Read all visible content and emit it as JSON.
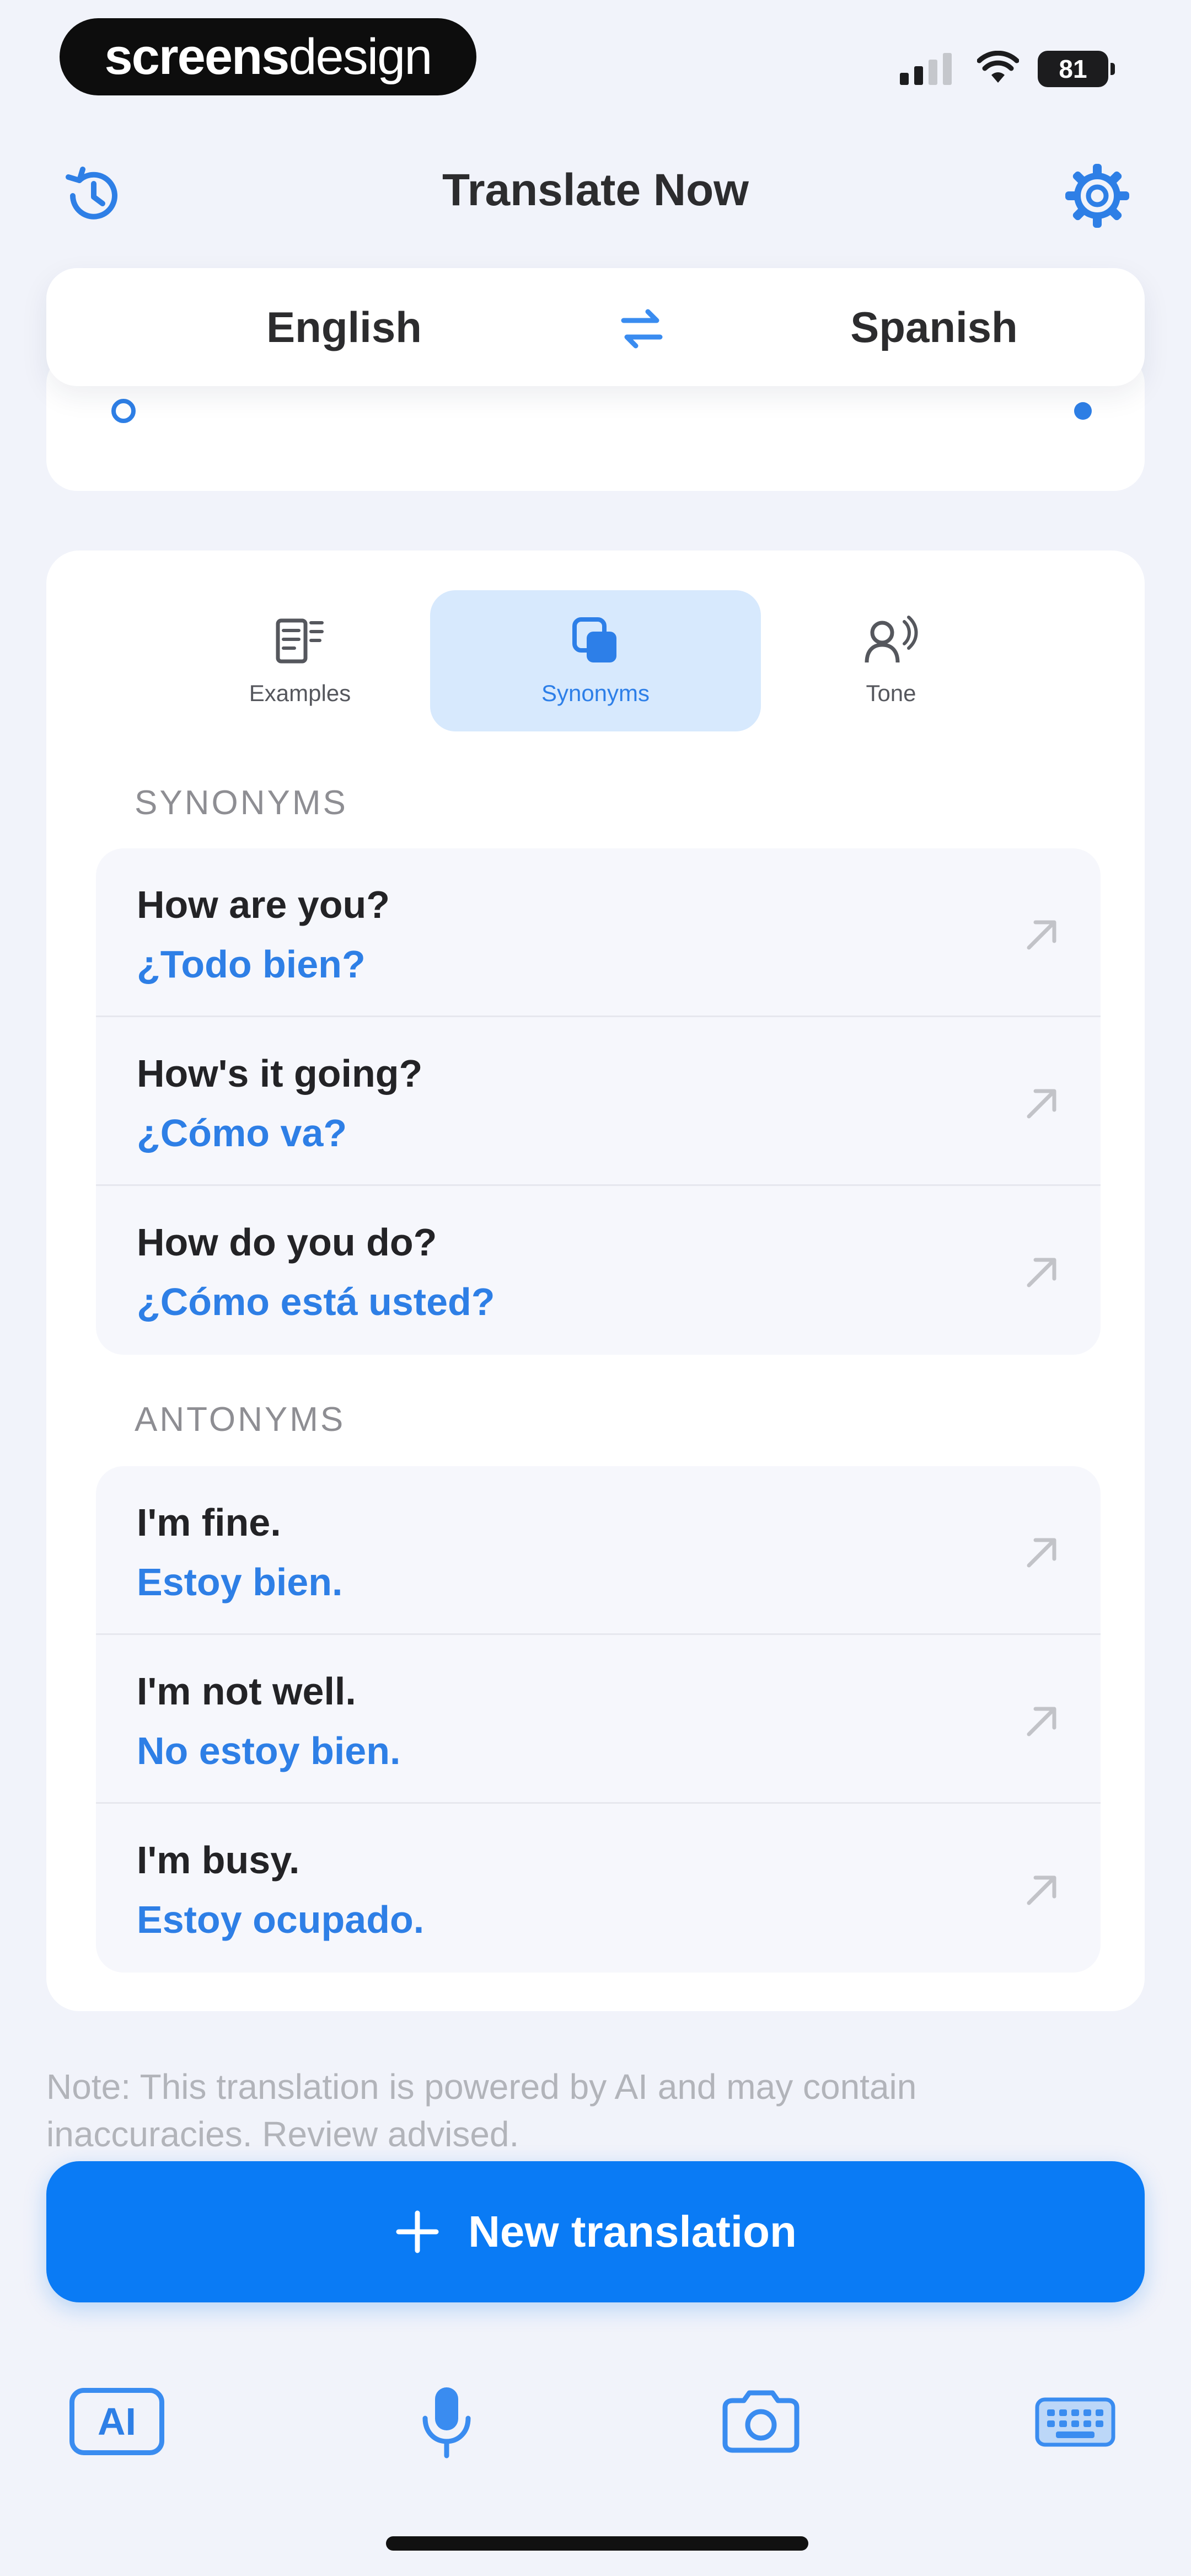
{
  "status_bar": {
    "watermark_a": "screens",
    "watermark_b": "design",
    "battery": "81"
  },
  "nav": {
    "title": "Translate Now"
  },
  "languages": {
    "source": "English",
    "target": "Spanish"
  },
  "tabs": [
    {
      "label": "Examples",
      "icon": "examples-icon"
    },
    {
      "label": "Synonyms",
      "icon": "synonyms-icon",
      "selected": true
    },
    {
      "label": "Tone",
      "icon": "tone-icon"
    }
  ],
  "sections": {
    "synonyms": {
      "label": "SYNONYMS",
      "items": [
        {
          "source": "How are you?",
          "target": "¿Todo bien?"
        },
        {
          "source": "How's it going?",
          "target": "¿Cómo va?"
        },
        {
          "source": "How do you do?",
          "target": "¿Cómo está usted?"
        }
      ]
    },
    "antonyms": {
      "label": "ANTONYMS",
      "items": [
        {
          "source": "I'm fine.",
          "target": "Estoy bien."
        },
        {
          "source": "I'm not well.",
          "target": "No estoy bien."
        },
        {
          "source": "I'm busy.",
          "target": "Estoy ocupado."
        }
      ]
    }
  },
  "disclaimer": "Note: This translation is powered by AI and may contain inaccuracies. Review advised.",
  "primary_button": {
    "label": "New translation"
  },
  "tab_bar": {
    "ai_label": "AI"
  },
  "colors": {
    "accent": "#0a7bf5",
    "accent_text": "#2e7fe6",
    "selected_tab_bg": "#d7e9fd"
  }
}
